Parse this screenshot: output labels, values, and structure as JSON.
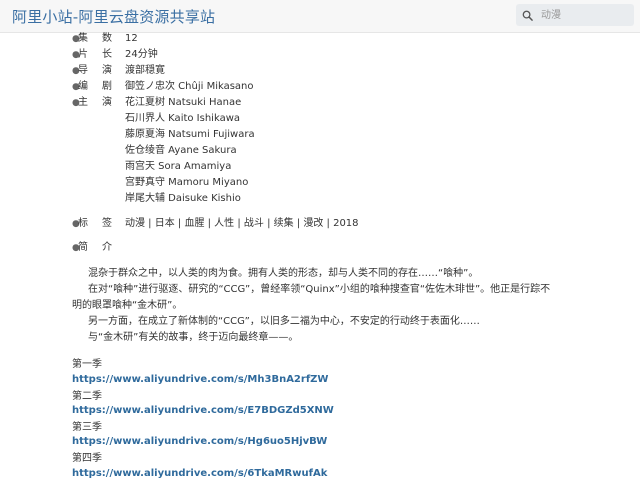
{
  "header": {
    "site_title": "阿里小站-阿里云盘资源共享站",
    "search_placeholder": "动漫"
  },
  "info": {
    "episodes": {
      "bullet": "●",
      "label_a": "集",
      "label_b": "数",
      "value": "12"
    },
    "duration": {
      "bullet": "●",
      "label_a": "片",
      "label_b": "长",
      "value": "24分钟"
    },
    "director": {
      "bullet": "●",
      "label_a": "导",
      "label_b": "演",
      "value": "渡部穏寛"
    },
    "writer": {
      "bullet": "●",
      "label_a": "编",
      "label_b": "剧",
      "value": "御笠ノ忠次 Chûji Mikasano"
    },
    "cast": {
      "bullet": "●",
      "label_a": "主",
      "label_b": "演",
      "names": [
        "花江夏树 Natsuki Hanae",
        "石川界人 Kaito Ishikawa",
        "藤原夏海 Natsumi Fujiwara",
        "佐仓绫音 Ayane Sakura",
        "雨宫天 Sora Amamiya",
        "宫野真守 Mamoru Miyano",
        "岸尾大辅 Daisuke Kishio"
      ]
    },
    "tags": {
      "bullet": "●",
      "label_a": "标",
      "label_b": "签",
      "value": "动漫 | 日本 | 血腥 | 人性 | 战斗 | 续集 | 漫改 | 2018"
    },
    "intro": {
      "bullet": "●",
      "label_a": "简",
      "label_b": "介"
    }
  },
  "synopsis": {
    "p1": "混杂于群众之中，以人类的肉为食。拥有人类的形态，却与人类不同的存在……“喰种”。",
    "p2": "在对“喰种”进行驱逐、研究的“CCG”，曾经率领“Quinx”小组的喰种搜查官“佐佐木琲世”。他正是行踪不明的眼罩喰种“金木研”。",
    "p3": "另一方面，在成立了新体制的“CCG”，以旧多二福为中心，不安定的行动终于表面化……",
    "p4": "与“金木研”有关的故事，终于迈向最终章——。"
  },
  "seasons": [
    {
      "label": "第一季",
      "url": "https://www.aliyundrive.com/s/Mh3BnA2rfZW"
    },
    {
      "label": "第二季",
      "url": "https://www.aliyundrive.com/s/E7BDGZd5XNW"
    },
    {
      "label": "第三季",
      "url": "https://www.aliyundrive.com/s/Hg6uo5HjvBW"
    },
    {
      "label": "第四季",
      "url": "https://www.aliyundrive.com/s/6TkaMRwufAk"
    }
  ]
}
